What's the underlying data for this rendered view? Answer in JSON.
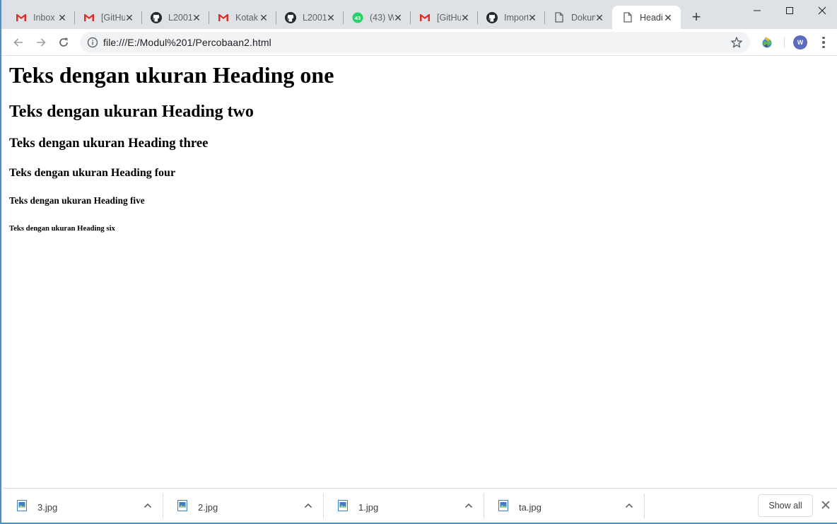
{
  "browser": {
    "tabs": [
      {
        "title": "Inbox",
        "icon": "gmail-icon"
      },
      {
        "title": "[GitHub]",
        "icon": "gmail-icon"
      },
      {
        "title": "L2001",
        "icon": "github-icon"
      },
      {
        "title": "Kotak",
        "icon": "gmail-icon"
      },
      {
        "title": "L2001",
        "icon": "github-icon"
      },
      {
        "title": "(43) W",
        "icon": "whatsapp-icon",
        "badge": "43"
      },
      {
        "title": "[GitHub]",
        "icon": "gmail-icon"
      },
      {
        "title": "Import",
        "icon": "github-icon"
      },
      {
        "title": "Dokum",
        "icon": "page-icon"
      },
      {
        "title": "Headi",
        "icon": "page-icon",
        "active": true
      }
    ],
    "new_tab_label": "+",
    "address_bar": {
      "url": "file:///E:/Modul%201/Percobaan2.html"
    },
    "avatar_letter": "W"
  },
  "page": {
    "h1": "Teks dengan ukuran Heading one",
    "h2": "Teks dengan ukuran Heading two",
    "h3": "Teks dengan ukuran Heading three",
    "h4": "Teks dengan ukuran Heading four",
    "h5": "Teks dengan ukuran Heading five",
    "h6": "Teks dengan ukuran Heading six"
  },
  "downloads": {
    "items": [
      {
        "name": "3.jpg"
      },
      {
        "name": "2.jpg"
      },
      {
        "name": "1.jpg"
      },
      {
        "name": "ta.jpg"
      }
    ],
    "show_all_label": "Show all"
  },
  "colors": {
    "tabstrip": "#dee1e6",
    "gmail_red": "#d93025",
    "whatsapp_green": "#25d366",
    "avatar": "#5c6bc0",
    "window_border": "#4a8fd4"
  }
}
